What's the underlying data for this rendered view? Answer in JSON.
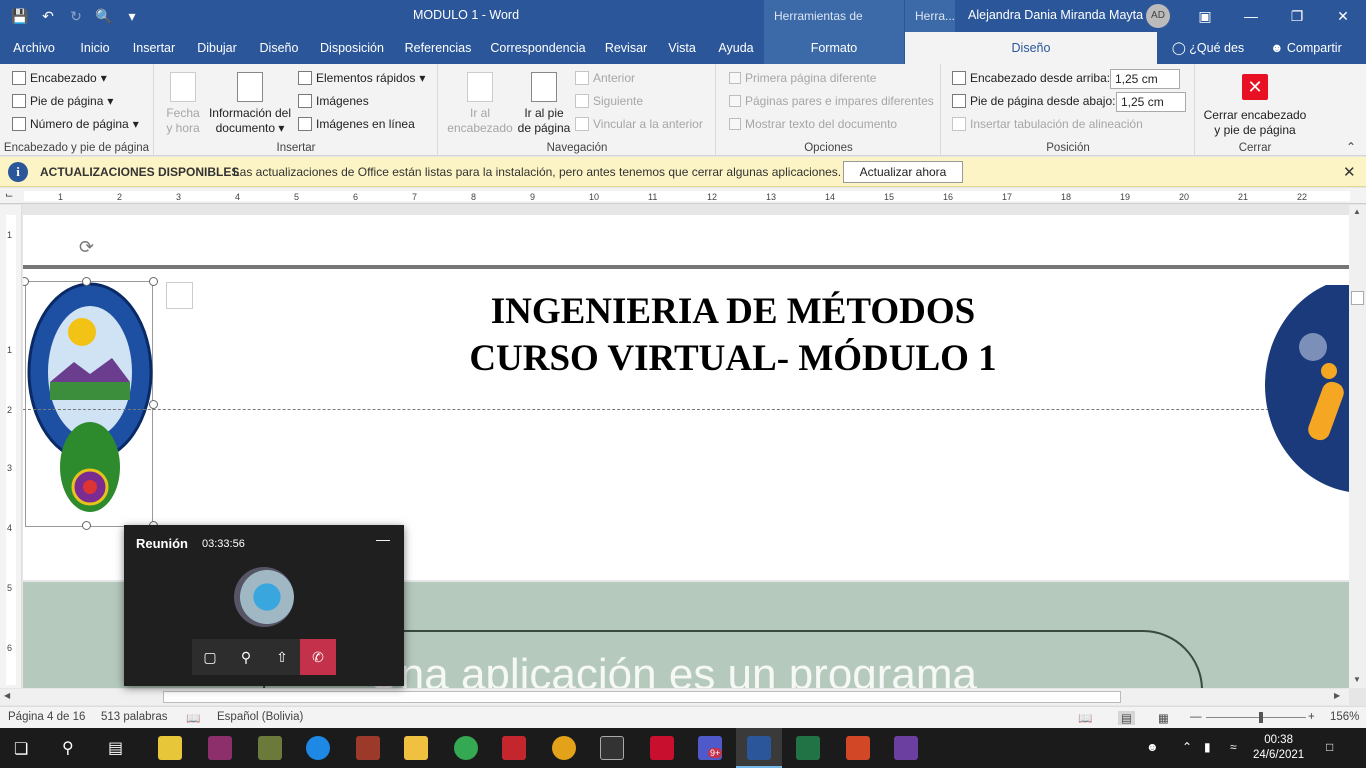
{
  "window": {
    "doc_title": "MODULO 1  -  Word",
    "context_tools": "Herramientas de imagen",
    "context_tools_short": "Herra...",
    "user_name": "Alejandra Dania Miranda Mayta",
    "user_initials": "AD"
  },
  "tabs": {
    "archivo": "Archivo",
    "inicio": "Inicio",
    "insertar": "Insertar",
    "dibujar": "Dibujar",
    "diseno": "Diseño",
    "disposicion": "Disposición",
    "referencias": "Referencias",
    "correspondencia": "Correspondencia",
    "revisar": "Revisar",
    "vista": "Vista",
    "ayuda": "Ayuda",
    "formato": "Formato",
    "diseno_ctx": "Diseño",
    "que_desea": "¿Qué des",
    "compartir": "Compartir"
  },
  "ribbon": {
    "hf_group": {
      "encabezado": "Encabezado",
      "pie_de_pagina": "Pie de página",
      "numero_de_pagina": "Número de página",
      "label": "Encabezado y pie de página"
    },
    "insert_group": {
      "fecha_hora_1": "Fecha",
      "fecha_hora_2": "y hora",
      "info_doc_1": "Información del",
      "info_doc_2": "documento",
      "elementos_rapidos": "Elementos rápidos",
      "imagenes": "Imágenes",
      "imagenes_en_linea": "Imágenes en línea",
      "label": "Insertar"
    },
    "nav_group": {
      "ir_encabezado_1": "Ir al",
      "ir_encabezado_2": "encabezado",
      "ir_pie_1": "Ir al pie",
      "ir_pie_2": "de página",
      "anterior": "Anterior",
      "siguiente": "Siguiente",
      "vincular": "Vincular a la anterior",
      "label": "Navegación"
    },
    "options_group": {
      "primera_pagina": "Primera página diferente",
      "pares_impares": "Páginas pares e impares diferentes",
      "mostrar_texto": "Mostrar texto del documento",
      "label": "Opciones"
    },
    "position_group": {
      "encabezado_arriba": "Encabezado desde arriba:",
      "encabezado_arriba_value": "1,25 cm",
      "pie_abajo": "Pie de página desde abajo:",
      "pie_abajo_value": "1,25 cm",
      "insertar_tab": "Insertar tabulación de alineación",
      "label": "Posición"
    },
    "close_group": {
      "cerrar_1": "Cerrar encabezado",
      "cerrar_2": "y pie de página",
      "label": "Cerrar"
    }
  },
  "infobar": {
    "title": "ACTUALIZACIONES DISPONIBLES",
    "message": "Las actualizaciones de Office están listas para la instalación, pero antes tenemos que cerrar algunas aplicaciones.",
    "button": "Actualizar ahora"
  },
  "ruler": {
    "marks": [
      "1",
      "2",
      "3",
      "4",
      "5",
      "6",
      "7",
      "8",
      "9",
      "10",
      "11",
      "12",
      "13",
      "14",
      "15",
      "16",
      "17",
      "18",
      "19",
      "20",
      "21",
      "22"
    ],
    "vmarks": [
      "1",
      "1",
      "2",
      "3",
      "4",
      "5",
      "6"
    ]
  },
  "document": {
    "heading_line1": "INGENIERIA DE MÉTODOS",
    "heading_line2": "CURSO VIRTUAL- MÓDULO 1",
    "slide_text": "Una aplicación es un programa"
  },
  "meeting": {
    "title": "Reunión",
    "time": "03:33:56"
  },
  "status": {
    "page": "Página 4 de 16",
    "words": "513 palabras",
    "language": "Español (Bolivia)",
    "zoom": "156%"
  },
  "taskbar": {
    "time": "00:38",
    "date": "24/6/2021",
    "teams_badge": "9+"
  }
}
